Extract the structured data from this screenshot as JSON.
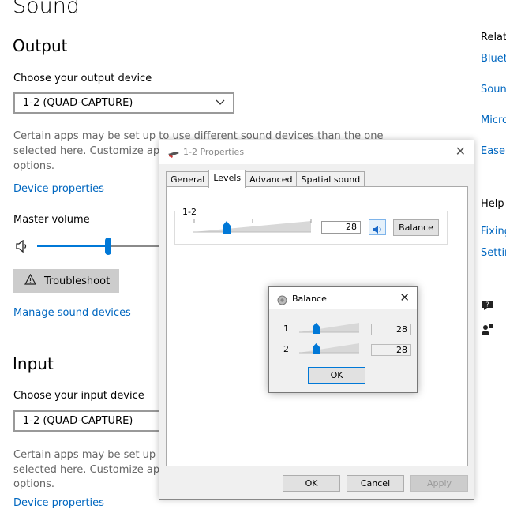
{
  "settings": {
    "title": "Sound",
    "output": {
      "heading": "Output",
      "choose_label": "Choose your output device",
      "device": "1-2 (QUAD-CAPTURE)",
      "desc": [
        "Certain apps may be set up to use different sound devices than the one",
        "selected here. Customize app",
        "options."
      ],
      "device_properties": "Device properties",
      "master_volume_label": "Master volume",
      "master_volume_fraction": 0.51,
      "troubleshoot": "Troubleshoot",
      "manage": "Manage sound devices"
    },
    "input": {
      "heading": "Input",
      "choose_label": "Choose your input device",
      "device": "1-2 (QUAD-CAPTURE)",
      "desc": [
        "Certain apps may be set up to",
        "selected here. Customize app",
        "options."
      ],
      "device_properties": "Device properties"
    },
    "related": {
      "heading": "Relate",
      "links": [
        "Bluet",
        "Soun",
        "Micro",
        "Ease"
      ]
    },
    "help": {
      "heading": "Help",
      "links": [
        "Fixing",
        "Settir"
      ]
    }
  },
  "properties_dialog": {
    "title": "1-2 Properties",
    "tabs": [
      "General",
      "Levels",
      "Advanced",
      "Spatial sound"
    ],
    "active_tab": "Levels",
    "level_label": "1-2",
    "level_value": "28",
    "balance_button": "Balance",
    "ok": "OK",
    "cancel": "Cancel",
    "apply": "Apply"
  },
  "balance_dialog": {
    "title": "Balance",
    "channels": [
      {
        "label": "1",
        "value": "28"
      },
      {
        "label": "2",
        "value": "28"
      }
    ],
    "ok": "OK"
  },
  "colors": {
    "accent": "#0078d7",
    "link": "#0067c0"
  }
}
